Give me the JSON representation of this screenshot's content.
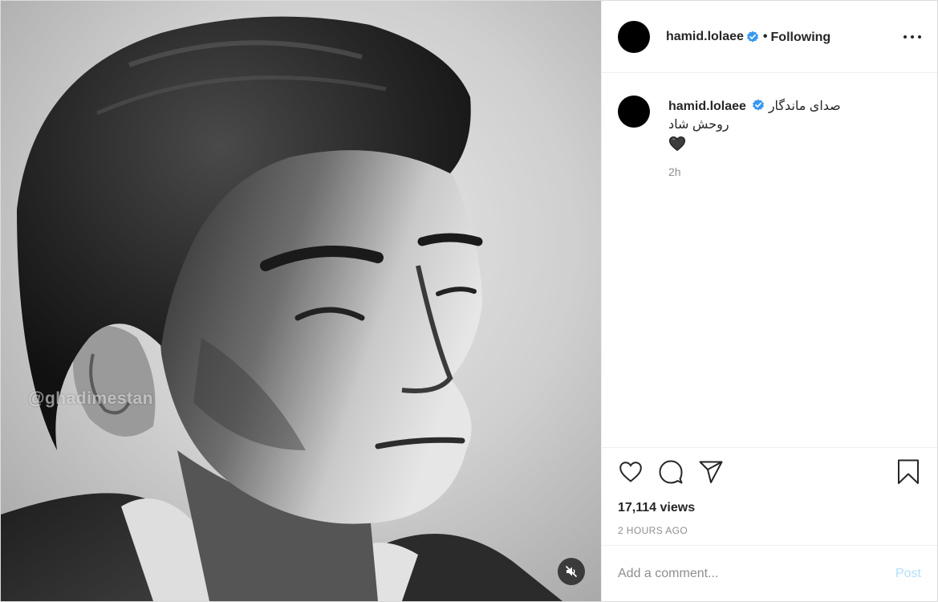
{
  "media": {
    "watermark": "@ghadimestan",
    "mute_icon": "speaker-muted-icon"
  },
  "header": {
    "username": "hamid.lolaee",
    "verified_icon": "verified-badge-icon",
    "separator": "•",
    "follow_status": "Following",
    "more_icon": "more-options-icon"
  },
  "caption": {
    "username": "hamid.lolaee",
    "line1": "صدای ماندگار",
    "line2": "روحش شاد",
    "emoji": "black-heart-emoji",
    "time": "2h"
  },
  "actions": {
    "like_icon": "heart-icon",
    "comment_icon": "comment-bubble-icon",
    "share_icon": "paper-plane-icon",
    "save_icon": "bookmark-icon",
    "views": "17,114 views",
    "posted_ago": "2 HOURS AGO"
  },
  "comment_box": {
    "placeholder": "Add a comment...",
    "value": "",
    "post_label": "Post"
  },
  "colors": {
    "text": "#262626",
    "secondary": "#8e8e8e",
    "verified": "#3897f0",
    "post_disabled": "#b2dffc",
    "divider": "#efefef"
  }
}
